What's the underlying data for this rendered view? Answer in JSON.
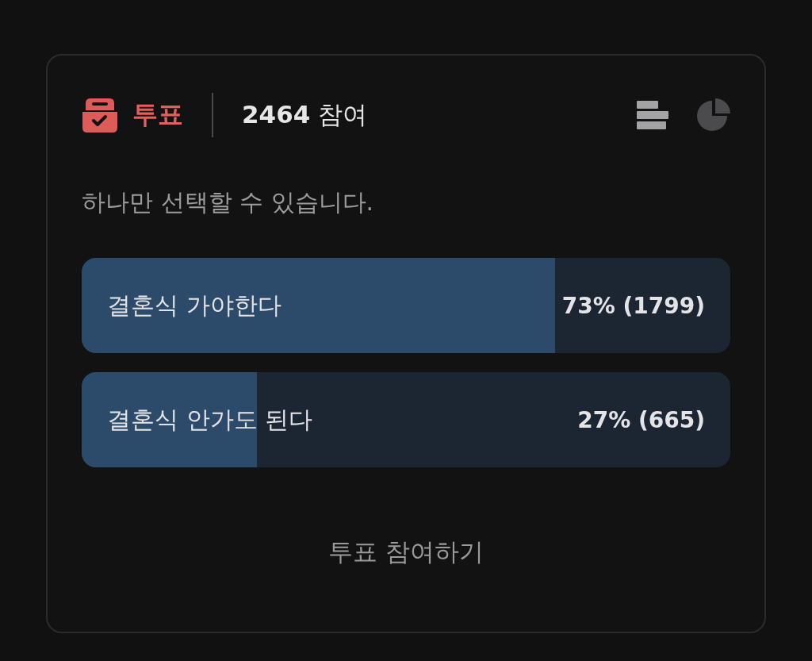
{
  "poll": {
    "title": "투표",
    "participants": "**2464** 참여",
    "views": [
      {
        "kind": "bar",
        "selected": true
      },
      {
        "kind": "pie",
        "selected": false
      }
    ],
    "instruction": "하나만 선택할 수 있습니다.",
    "options": [
      {
        "label": "결혼식 가야한다",
        "reading": "73% (1799)",
        "level": 0.73
      },
      {
        "label": "결혼식 안가도 된다",
        "reading": "27% (665)",
        "level": 0.27
      }
    ],
    "button": "투표 참여하기"
  }
}
